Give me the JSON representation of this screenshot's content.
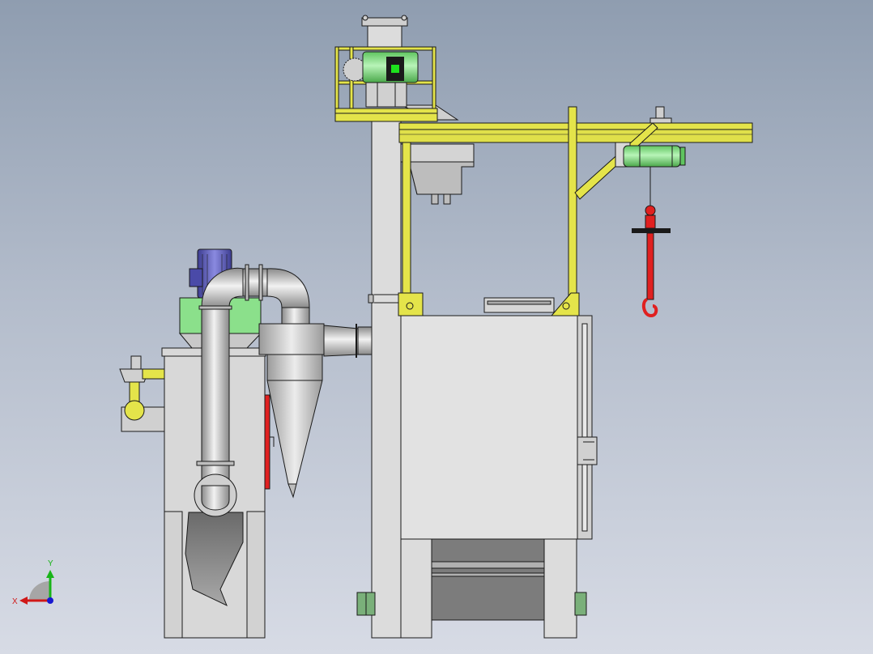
{
  "viewport": {
    "background_top": "#8f9db0",
    "background_bottom": "#d7dbe5"
  },
  "colors": {
    "steel": "#d4d4d4",
    "steel_dark": "#8e8e8e",
    "outline": "#1a1a1a",
    "yellow": "#e4e44a",
    "green": "#7ddc7d",
    "bright_green": "#1de01d",
    "red": "#e02020",
    "motor_blue": "#5a5ab8",
    "hopper_gray": "#7c7c7c"
  },
  "triad": {
    "x_label": "X",
    "y_label": "Y",
    "x_color": "#d01818",
    "y_color": "#18b418",
    "z_color": "#1818d0"
  }
}
